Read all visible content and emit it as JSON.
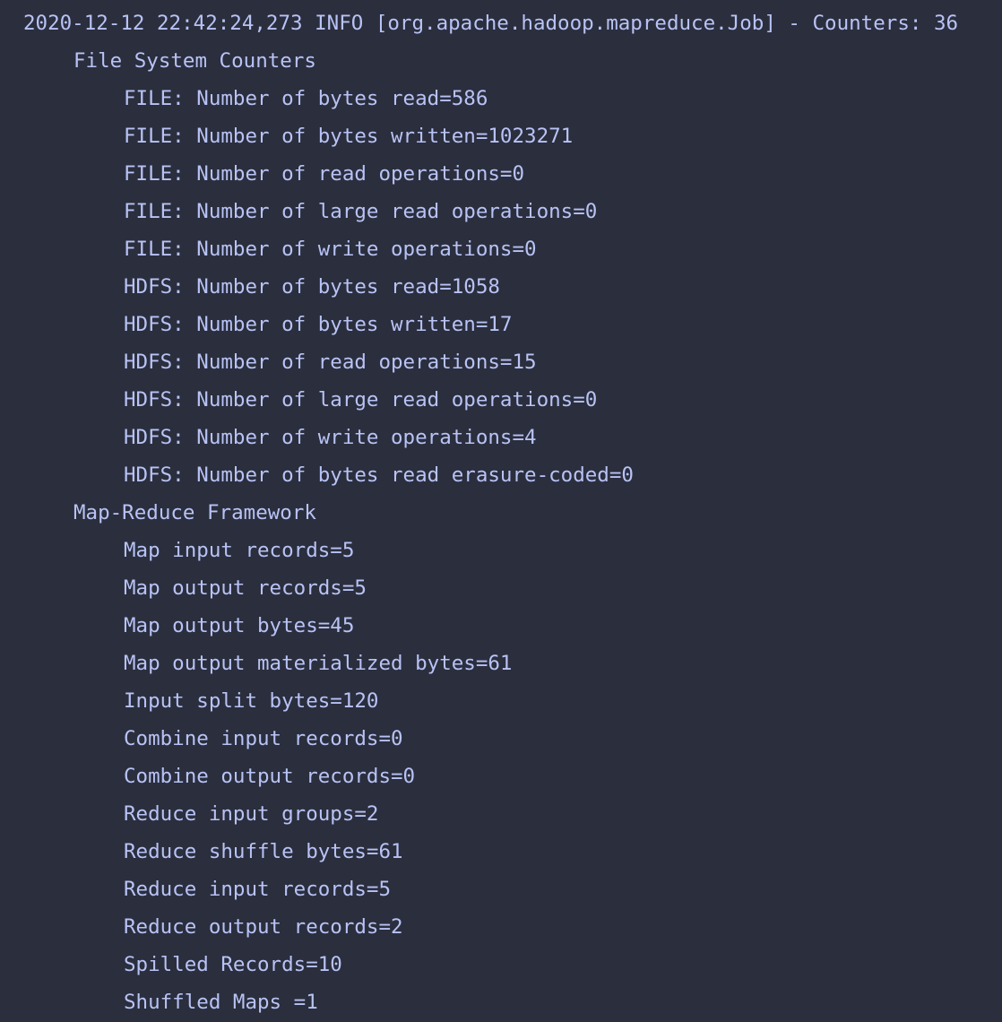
{
  "terminal": {
    "header_line": "2020-12-12 22:42:24,273 INFO [org.apache.hadoop.mapreduce.Job] - Counters: 36",
    "groups": [
      {
        "name": "File System Counters",
        "counters": [
          "FILE: Number of bytes read=586",
          "FILE: Number of bytes written=1023271",
          "FILE: Number of read operations=0",
          "FILE: Number of large read operations=0",
          "FILE: Number of write operations=0",
          "HDFS: Number of bytes read=1058",
          "HDFS: Number of bytes written=17",
          "HDFS: Number of read operations=15",
          "HDFS: Number of large read operations=0",
          "HDFS: Number of write operations=4",
          "HDFS: Number of bytes read erasure-coded=0"
        ]
      },
      {
        "name": "Map-Reduce Framework",
        "counters": [
          "Map input records=5",
          "Map output records=5",
          "Map output bytes=45",
          "Map output materialized bytes=61",
          "Input split bytes=120",
          "Combine input records=0",
          "Combine output records=0",
          "Reduce input groups=2",
          "Reduce shuffle bytes=61",
          "Reduce input records=5",
          "Reduce output records=2",
          "Spilled Records=10",
          "Shuffled Maps =1"
        ]
      }
    ]
  }
}
